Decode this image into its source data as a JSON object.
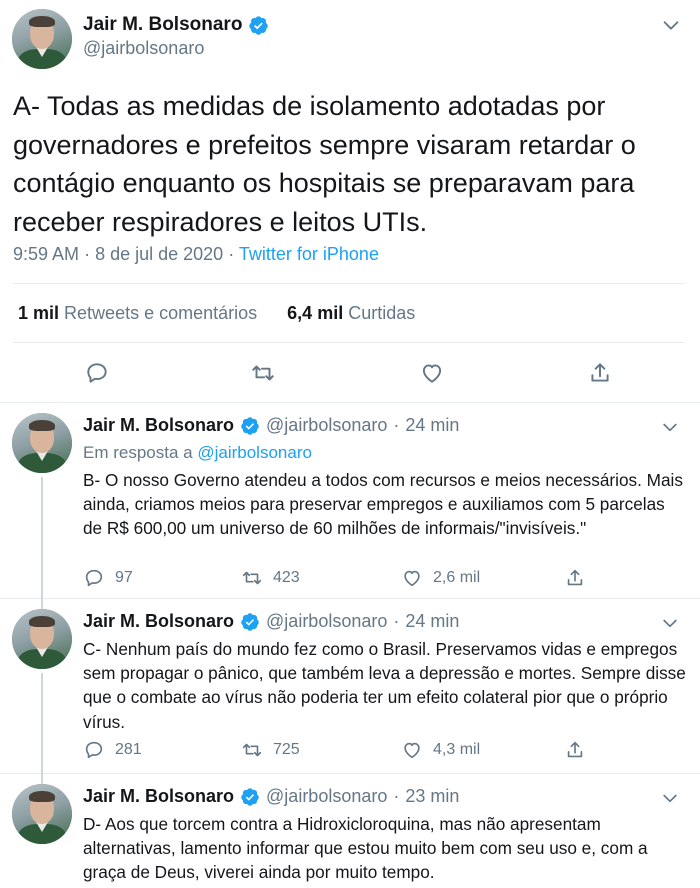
{
  "main_tweet": {
    "author_name": "Jair M. Bolsonaro",
    "author_handle": "@jairbolsonaro",
    "text": "A- Todas as medidas de isolamento adotadas por governadores e prefeitos sempre visaram retardar o contágio enquanto os hospitais se preparavam para receber respiradores e leitos UTIs.",
    "time": "9:59 AM",
    "separator": "·",
    "date": "8 de jul de 2020",
    "source": "Twitter for iPhone",
    "retweets_count": "1 mil",
    "retweets_label": "Retweets e comentários",
    "likes_count": "6,4 mil",
    "likes_label": "Curtidas",
    "icons": {
      "reply": "reply-icon",
      "retweet": "retweet-icon",
      "like": "heart-icon",
      "share": "share-icon",
      "verified": "verified-badge-icon",
      "menu": "chevron-down-icon"
    }
  },
  "replies": [
    {
      "author_name": "Jair M. Bolsonaro",
      "author_handle": "@jairbolsonaro",
      "separator": "·",
      "time_ago": "24 min",
      "reply_to_label": "Em resposta a",
      "reply_to_handle": "@jairbolsonaro",
      "text": "B- O nosso Governo atendeu a todos com recursos e meios necessários. Mais ainda, criamos meios para preservar empregos e auxiliamos com 5 parcelas de R$ 600,00 um universo de 60 milhões de informais/\"invisíveis.\"",
      "replies_count": "97",
      "retweets_count": "423",
      "likes_count": "2,6 mil"
    },
    {
      "author_name": "Jair M. Bolsonaro",
      "author_handle": "@jairbolsonaro",
      "separator": "·",
      "time_ago": "24 min",
      "text": "C- Nenhum país do mundo fez como o Brasil. Preservamos vidas e empregos sem propagar o pânico, que também leva a depressão e mortes. Sempre disse que o combate ao vírus não poderia ter um efeito colateral pior que o próprio vírus.",
      "replies_count": "281",
      "retweets_count": "725",
      "likes_count": "4,3 mil"
    },
    {
      "author_name": "Jair M. Bolsonaro",
      "author_handle": "@jairbolsonaro",
      "separator": "·",
      "time_ago": "23 min",
      "text": "D- Aos que torcem contra a Hidroxicloroquina, mas não apresentam alternativas, lamento informar que estou muito bem com seu uso e, com a graça de Deus, viverei ainda por muito tempo."
    }
  ],
  "colors": {
    "accent": "#1da1f2",
    "text": "#14171a",
    "muted": "#657786",
    "border": "#e6ecf0"
  }
}
